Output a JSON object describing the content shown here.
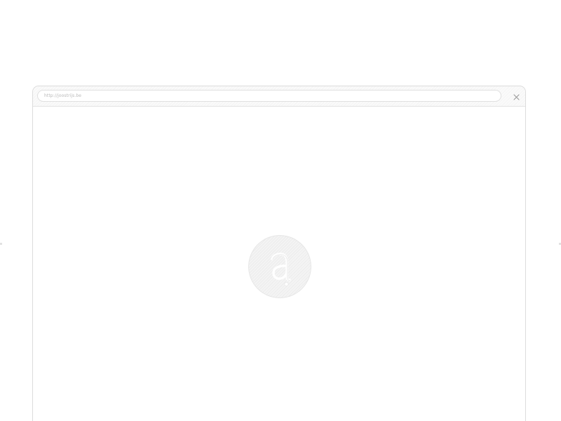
{
  "browser": {
    "url": "http://joostrijs.be"
  },
  "icons": {
    "close": "close-icon",
    "logo": "letter-a-logo-icon"
  },
  "colors": {
    "window_border": "#dcdcdc",
    "toolbar_bg": "#fafafa",
    "url_text": "#b9b9b9",
    "logo_bg": "#f4f4f4",
    "logo_glyph": "#ffffff"
  }
}
